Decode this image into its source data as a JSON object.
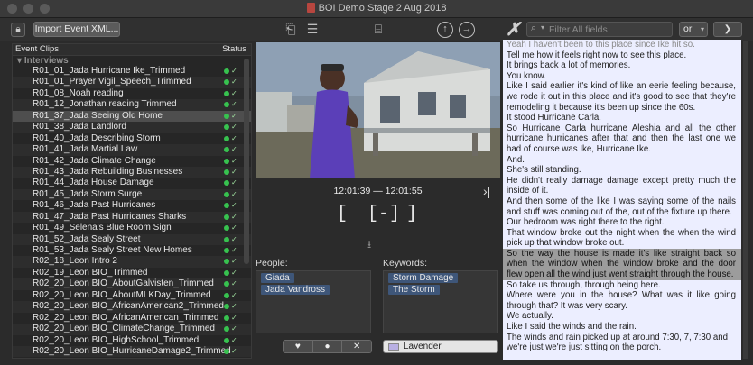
{
  "window": {
    "title": "BOI Demo Stage 2 Aug 2018"
  },
  "toolbar": {
    "import_label": "Import Event XML...",
    "lock_icon": "lock-icon",
    "filter_placeholder": "Filter All fields",
    "or_option": "or",
    "next_label": "❯"
  },
  "clips": {
    "col_event": "Event Clips",
    "col_status": "Status",
    "group": "Interviews",
    "items": [
      "R01_01_Jada Hurricane Ike_Trimmed",
      "R01_01_Prayer Vigil_Speech_Trimmed",
      "R01_08_Noah reading",
      "R01_12_Jonathan reading Trimmed",
      "R01_37_Jada Seeing Old Home",
      "R01_38_Jada Landlord",
      "R01_40_Jada Describing Storm",
      "R01_41_Jada Martial Law",
      "R01_42_Jada Climate Change",
      "R01_43_Jada Rebuilding Businesses",
      "R01_44_Jada House Damage",
      "R01_45_Jada Storm Surge",
      "R01_46_Jada Past Hurricanes",
      "R01_47_Jada Past Hurricanes Sharks",
      "R01_49_Selena's Blue Room Sign",
      "R01_52_Jada Sealy Street",
      "R01_53_Jada Sealy Street New Homes",
      "R02_18_Leon Intro 2",
      "R02_19_Leon BIO_Trimmed",
      "R02_20_Leon BIO_AboutGalvisten_Trimmed",
      "R02_20_Leon BIO_AboutMLKDay_Trimmed",
      "R02_20_Leon BIO_AfricanAmerican2_Trimmed",
      "R02_20_Leon BIO_AfricanAmerican_Trimmed",
      "R02_20_Leon BIO_ClimateChange_Trimmed",
      "R02_20_Leon BIO_HighSchool_Trimmed",
      "R02_20_Leon BIO_HurricaneDamage2_Trimmed"
    ],
    "selected_index": 4,
    "status_color": "#37c24f"
  },
  "player": {
    "timecode": "12:01:39 — 12:01:55"
  },
  "people": {
    "label": "People:",
    "items": [
      "Giada",
      "Jada Vandross"
    ]
  },
  "keywords": {
    "label": "Keywords:",
    "items": [
      "Storm Damage",
      "The Storm"
    ]
  },
  "rating": {
    "favorite": "♥",
    "neutral": "●",
    "reject": "✕"
  },
  "color_label": {
    "value": "Lavender",
    "swatch": "#b9b0e3"
  },
  "transcript": {
    "lines": [
      {
        "text": "Yeah I haven't been to this place since Ike hit so.",
        "style": "dim"
      },
      {
        "text": "Tell me how it feels right now to see this place.",
        "style": ""
      },
      {
        "text": "It brings back a lot of memories.",
        "style": ""
      },
      {
        "text": "You know.",
        "style": ""
      },
      {
        "text": "Like I said earlier it's kind of like an eerie feeling because, we rode it out in this place and it's good to see that they're remodeling it because it's been up since the 60s.",
        "style": ""
      },
      {
        "text": "It stood Hurricane Carla.",
        "style": ""
      },
      {
        "text": "So Hurricane Carla hurricane Aleshia and all the other hurricane hurricanes after that and then the last one we had of course was Ike, Hurricane Ike.",
        "style": ""
      },
      {
        "text": "And.",
        "style": ""
      },
      {
        "text": "She's still standing.",
        "style": ""
      },
      {
        "text": "He didn't really damage damage except pretty much the inside of it.",
        "style": ""
      },
      {
        "text": "And then some of the like I was saying some of the nails and stuff was coming out of the, out of the fixture up there.",
        "style": ""
      },
      {
        "text": "Our bedroom was right there to the right.",
        "style": ""
      },
      {
        "text": "That window broke out the night when the when the wind pick up that window broke out.",
        "style": ""
      },
      {
        "text": "So the way the house is made it's like straight back so when the window when the window broke and the door flew open all the wind just went straight through the house.",
        "style": "hl"
      },
      {
        "text": "So take us through, through being here.",
        "style": ""
      },
      {
        "text": "Where were you in the house? What was it like going through that? It was very scary.",
        "style": ""
      },
      {
        "text": "We actually.",
        "style": ""
      },
      {
        "text": "Like I said the winds and the rain.",
        "style": ""
      },
      {
        "text": "The winds and rain picked up at around 7:30, 7, 7:30 and we're just we're just sitting on the porch.",
        "style": "last"
      }
    ]
  }
}
